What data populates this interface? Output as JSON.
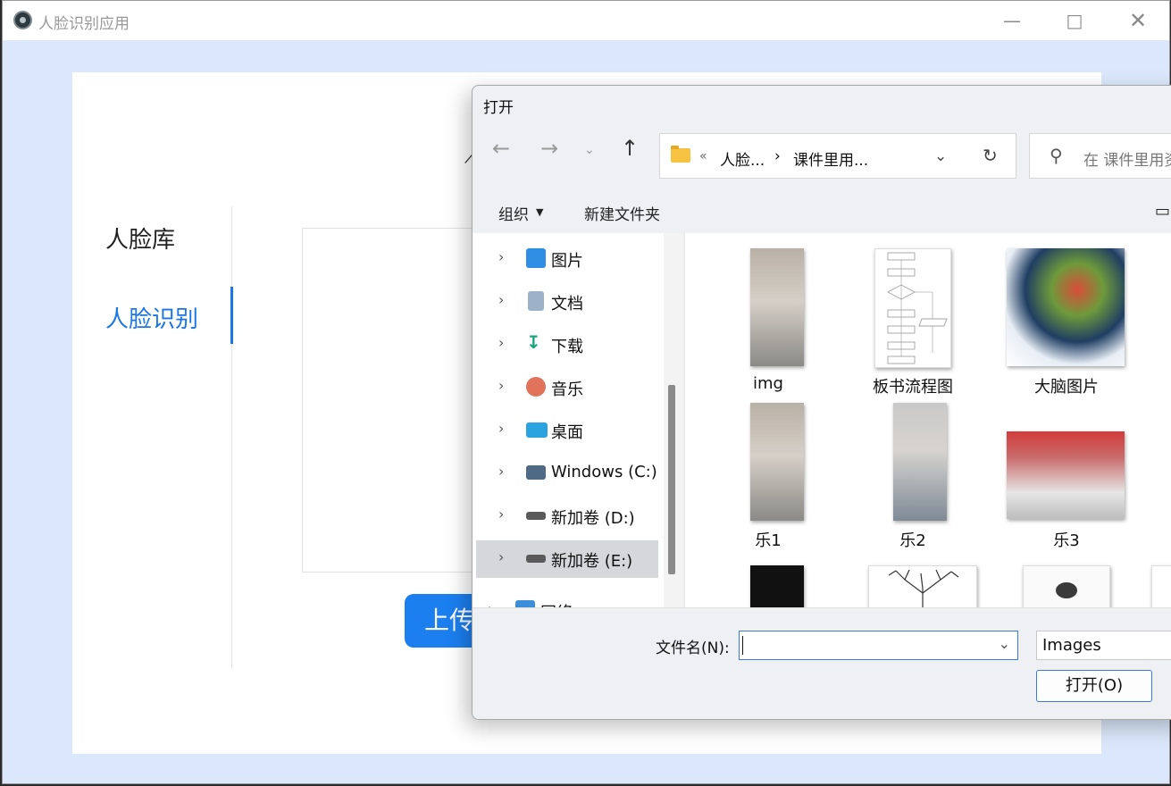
{
  "app": {
    "title": "人脸识别应用",
    "minimize_icon": "minimize-icon",
    "maximize_icon": "maximize-icon",
    "close_icon": "close-icon"
  },
  "sidebar": {
    "items": [
      {
        "label": "人脸库",
        "active": false
      },
      {
        "label": "人脸识别",
        "active": true
      }
    ],
    "accent_color": "#1b76e6"
  },
  "main": {
    "upload_button_label": "上传"
  },
  "dialog": {
    "title": "打开",
    "address": {
      "overflow_marker": "«",
      "crumbs": [
        "人脸...",
        "课件里用..."
      ]
    },
    "search_placeholder": "在 课件里用资料",
    "toolbar": {
      "organize_label": "组织",
      "new_folder_label": "新建文件夹"
    },
    "nav_items": [
      {
        "label": "图片",
        "icon": "pictures-icon"
      },
      {
        "label": "文档",
        "icon": "documents-icon"
      },
      {
        "label": "下载",
        "icon": "download-icon"
      },
      {
        "label": "音乐",
        "icon": "music-icon"
      },
      {
        "label": "桌面",
        "icon": "desktop-icon"
      },
      {
        "label": "Windows  (C:)",
        "icon": "windows-drive-icon"
      },
      {
        "label": "新加卷 (D:)",
        "icon": "drive-icon"
      },
      {
        "label": "新加卷 (E:)",
        "icon": "drive-icon",
        "selected": true
      },
      {
        "label": "网络",
        "icon": "network-icon"
      }
    ],
    "files": [
      {
        "name": "img"
      },
      {
        "name": "板书流程图"
      },
      {
        "name": "大脑图片"
      },
      {
        "name": "乐1"
      },
      {
        "name": "乐2"
      },
      {
        "name": "乐3"
      }
    ],
    "filename_label": "文件名(N):",
    "filename_value": "",
    "filter_value": "Images",
    "open_button_label": "打开(O)"
  }
}
